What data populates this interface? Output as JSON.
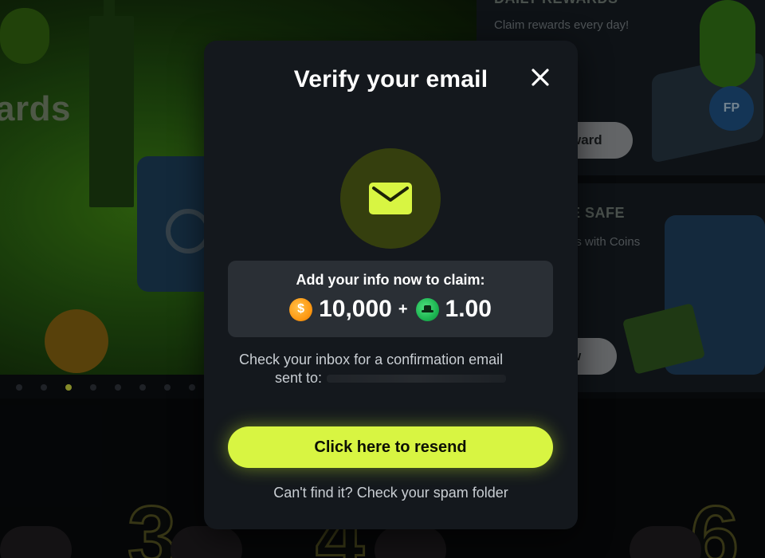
{
  "background": {
    "hero_text": "ards",
    "carousel_dots_count": 8,
    "carousel_active_index": 2,
    "card_daily": {
      "title": "DAILY REWARDS",
      "subtitle": "Claim rewards every day!",
      "button_label": "ward",
      "art_badge": "FP"
    },
    "card_safe": {
      "title": "E SAFE",
      "subtitle": "ds with Coins",
      "button_label": "w"
    },
    "bottom_numbers": [
      "3",
      "4",
      "6"
    ]
  },
  "modal": {
    "title": "Verify your email",
    "close_icon": "close-icon",
    "mail_icon": "envelope-icon",
    "claim_label": "Add your info now to claim:",
    "gold_coins": "10,000",
    "plus": "+",
    "sweeps_coins": "1.00",
    "info_line1": "Check your inbox for a confirmation email",
    "info_line2": "sent to:",
    "resend_label": "Click here to resend",
    "spam_hint": "Can't find it? Check your spam folder"
  },
  "colors": {
    "accent": "#d8f542",
    "modal_bg": "#14181d",
    "claim_box_bg": "#2a2f35",
    "mail_circle_bg": "#353f0e"
  }
}
